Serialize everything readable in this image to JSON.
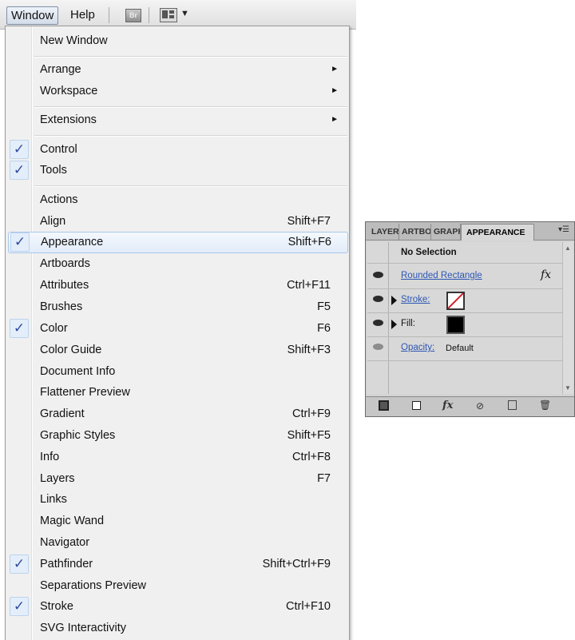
{
  "menubar": {
    "window_label": "Window",
    "help_label": "Help",
    "bridge_label": "Br"
  },
  "menu": {
    "items": [
      {
        "label": "New Window"
      },
      {
        "label": "Arrange"
      },
      {
        "label": "Workspace"
      },
      {
        "label": "Extensions"
      },
      {
        "label": "Control",
        "checked": true
      },
      {
        "label": "Tools",
        "checked": true
      },
      {
        "label": "Actions"
      },
      {
        "label": "Align",
        "shortcut": "Shift+F7"
      },
      {
        "label": "Appearance",
        "shortcut": "Shift+F6",
        "checked": true,
        "highlighted": true
      },
      {
        "label": "Artboards"
      },
      {
        "label": "Attributes",
        "shortcut": "Ctrl+F11"
      },
      {
        "label": "Brushes",
        "shortcut": "F5"
      },
      {
        "label": "Color",
        "shortcut": "F6",
        "checked": true
      },
      {
        "label": "Color Guide",
        "shortcut": "Shift+F3"
      },
      {
        "label": "Document Info"
      },
      {
        "label": "Flattener Preview"
      },
      {
        "label": "Gradient",
        "shortcut": "Ctrl+F9"
      },
      {
        "label": "Graphic Styles",
        "shortcut": "Shift+F5"
      },
      {
        "label": "Info",
        "shortcut": "Ctrl+F8"
      },
      {
        "label": "Layers",
        "shortcut": "F7"
      },
      {
        "label": "Links"
      },
      {
        "label": "Magic Wand"
      },
      {
        "label": "Navigator"
      },
      {
        "label": "Pathfinder",
        "shortcut": "Shift+Ctrl+F9",
        "checked": true
      },
      {
        "label": "Separations Preview"
      },
      {
        "label": "Stroke",
        "shortcut": "Ctrl+F10",
        "checked": true
      },
      {
        "label": "SVG Interactivity"
      }
    ],
    "check_glyph": "✓",
    "submenu_glyph": "►"
  },
  "panel": {
    "tabs": [
      "LAYERS",
      "ARTBOARDS",
      "GRAPHIC STYLES",
      "APPEARANCE"
    ],
    "active_tab": "APPEARANCE",
    "selection_label": "No Selection",
    "object_label": "Rounded Rectangle",
    "fx_label": "fx",
    "stroke_label": "Stroke:",
    "fill_label": "Fill:",
    "opacity_label": "Opacity:",
    "opacity_value": "Default",
    "colors": {
      "fill": "#000000",
      "stroke_none": "#d0202a",
      "link": "#2d56b4",
      "check": "#2f4c9f"
    }
  }
}
